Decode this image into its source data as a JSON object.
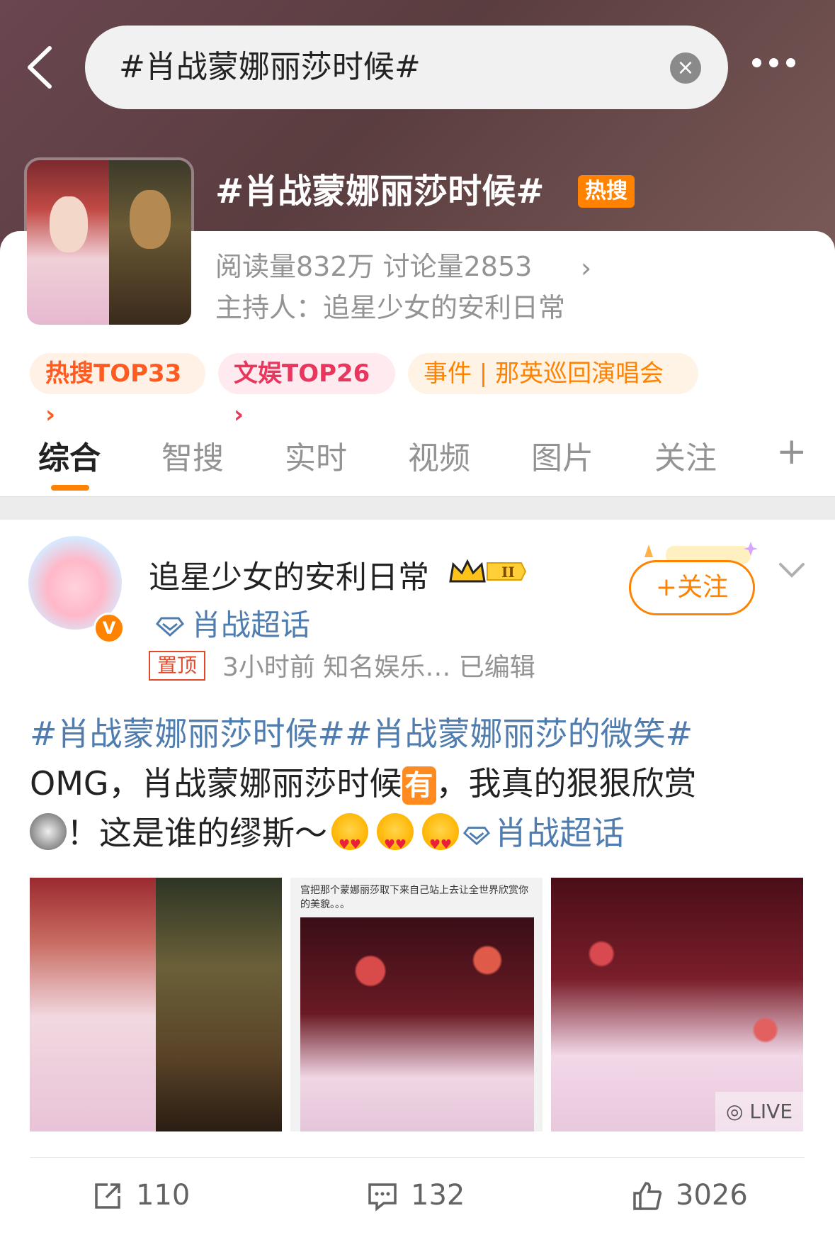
{
  "search": {
    "query": "#肖战蒙娜丽莎时候#"
  },
  "topic": {
    "title": "#肖战蒙娜丽莎时候#",
    "hot_badge": "热搜",
    "stats": "阅读量832万  讨论量2853",
    "host": "主持人：追星少女的安利日常"
  },
  "tags": [
    {
      "label": "热搜TOP33 ›"
    },
    {
      "label": "文娱TOP26 ›"
    },
    {
      "label": "事件 | 那英巡回演唱会"
    }
  ],
  "tabs": [
    {
      "label": "综合"
    },
    {
      "label": "智搜"
    },
    {
      "label": "实时"
    },
    {
      "label": "视频"
    },
    {
      "label": "图片"
    },
    {
      "label": "关注"
    }
  ],
  "post": {
    "author": "追星少女的安利日常",
    "super_topic": "肖战超话",
    "follow_label": "+关注",
    "pin_label": "置顶",
    "meta": "3小时前  知名娱乐…  已编辑",
    "text_link": "#肖战蒙娜丽莎时候##肖战蒙娜丽莎的微笑#",
    "text_1": "OMG，肖战蒙娜丽莎时候",
    "you_badge": "有",
    "text_2": "，我真的狠狠欣赏",
    "text_3": "！这是谁的缪斯～",
    "text_super_topic": "肖战超话",
    "image2_caption": "宫把那个蒙娜丽莎取下来自己站上去让全世界欣赏你的美貌。。。",
    "live_label": "LIVE",
    "reposts": "110",
    "comments": "132",
    "likes": "3026"
  },
  "colors": {
    "accent": "#ff8200",
    "link": "#507daf",
    "muted": "#939393"
  }
}
